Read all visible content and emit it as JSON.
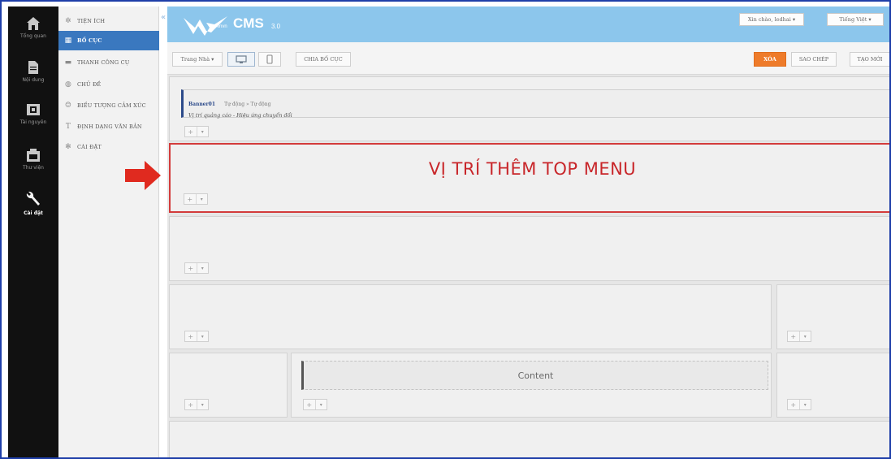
{
  "rail": {
    "items": [
      {
        "icon": "home-icon",
        "label": "Tổng quan"
      },
      {
        "icon": "document-icon",
        "label": "Nội dung"
      },
      {
        "icon": "resource-icon",
        "label": "Tài nguyên"
      },
      {
        "icon": "library-icon",
        "label": "Thư viện"
      },
      {
        "icon": "wrench-icon",
        "label": "Cài đặt"
      }
    ],
    "active_index": 4
  },
  "menu": {
    "items": [
      {
        "icon": "widgets-icon",
        "label": "TIỆN ÍCH"
      },
      {
        "icon": "layout-icon",
        "label": "BỐ CỤC"
      },
      {
        "icon": "toolbar-icon",
        "label": "THANH CÔNG CỤ"
      },
      {
        "icon": "theme-icon",
        "label": "CHỦ ĐỀ"
      },
      {
        "icon": "emoticon-icon",
        "label": "BIỂU TƯỢNG CẢM XÚC"
      },
      {
        "icon": "text-format-icon",
        "label": "ĐỊNH DẠNG VĂN BẢN"
      },
      {
        "icon": "settings-icon",
        "label": "CÀI ĐẶT"
      }
    ],
    "active_index": 1,
    "collapse_glyph": "«"
  },
  "header": {
    "logo_text": "CMS",
    "logo_version": "3.0",
    "logo_sub": "vnvn",
    "user_dropdown": "Xin chào, ledhai ▾",
    "language_dropdown": "Tiếng Việt ▾",
    "colors": {
      "bar": "#8cc6ec"
    }
  },
  "toolbar": {
    "page_select": "Trang Nhà ▾",
    "split_layout": "CHIA BỐ CỤC",
    "delete": "XÓA",
    "copy": "SAO CHÉP",
    "create_new": "TẠO MỚI",
    "colors": {
      "delete": "#ee7b2a"
    }
  },
  "canvas": {
    "banner_widget": {
      "name": "Banner01",
      "meta": "Tự động » Tự động",
      "description": "Vị trí quảng cáo - Hiệu ứng chuyển đổi"
    },
    "top_menu_label": "VỊ TRÍ THÊM TOP MENU",
    "content_widget": "Content",
    "add_glyph": "+",
    "more_glyph": "▾",
    "colors": {
      "highlight": "#d33b3b",
      "label": "#c8262a"
    }
  }
}
